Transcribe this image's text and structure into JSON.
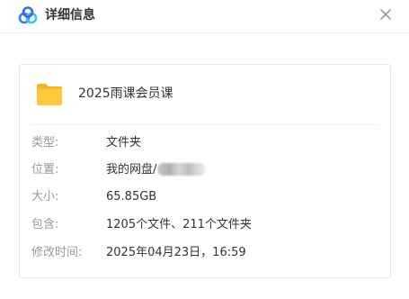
{
  "dialog": {
    "title": "详细信息",
    "logo_icon": "baidu-netdisk-logo-icon",
    "close_icon": "close-icon"
  },
  "file": {
    "icon": "folder-icon",
    "name": "2025雨课会员课"
  },
  "details": [
    {
      "label": "类型:",
      "value": "文件夹"
    },
    {
      "label": "位置:",
      "value": "我的网盘/"
    },
    {
      "label": "大小:",
      "value": "65.85GB"
    },
    {
      "label": "包含:",
      "value": "1205个文件、211个文件夹"
    },
    {
      "label": "修改时间:",
      "value": "2025年04月23日，16:59"
    }
  ],
  "colors": {
    "folder": "#FFC93C",
    "folder_dark": "#F5B41F",
    "logo_blue": "#3E7BFA",
    "logo_cyan": "#35C7E8"
  }
}
